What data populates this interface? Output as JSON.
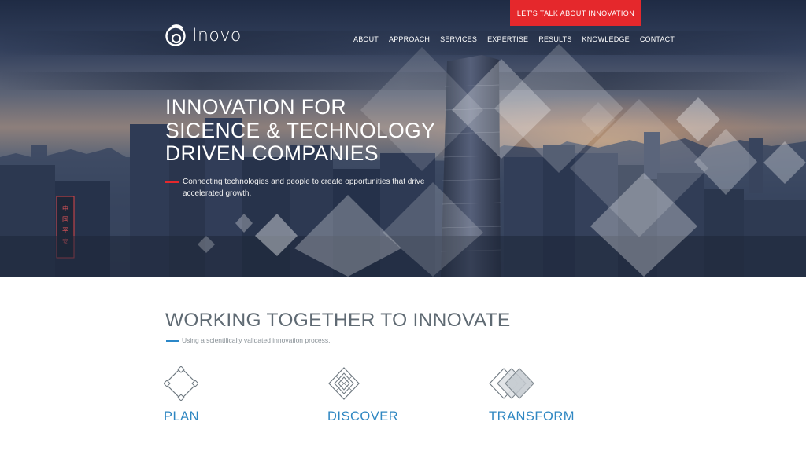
{
  "brand": {
    "name": "Inovo"
  },
  "cta": {
    "label": "LET'S TALK ABOUT INNOVATION"
  },
  "nav": {
    "items": [
      "ABOUT",
      "APPROACH",
      "SERVICES",
      "EXPERTISE",
      "RESULTS",
      "KNOWLEDGE",
      "CONTACT"
    ]
  },
  "hero": {
    "title_lines": [
      "INNOVATION FOR",
      "SICENCE & TECHNOLOGY",
      "DRIVEN COMPANIES"
    ],
    "subtitle": "Connecting technologies and people to create opportunities that drive accelerated growth.",
    "sign_text": "中国平安"
  },
  "process": {
    "title": "WORKING TOGETHER TO INNOVATE",
    "subtitle": "Using a scientifically validated innovation process.",
    "steps": [
      {
        "label": "PLAN",
        "icon": "plan-diamond-icon"
      },
      {
        "label": "DISCOVER",
        "icon": "discover-diamond-icon"
      },
      {
        "label": "TRANSFORM",
        "icon": "transform-diamonds-icon"
      }
    ]
  },
  "colors": {
    "accent_red": "#e5282c",
    "accent_blue": "#2f87c2",
    "heading_gray": "#5f6a73"
  }
}
